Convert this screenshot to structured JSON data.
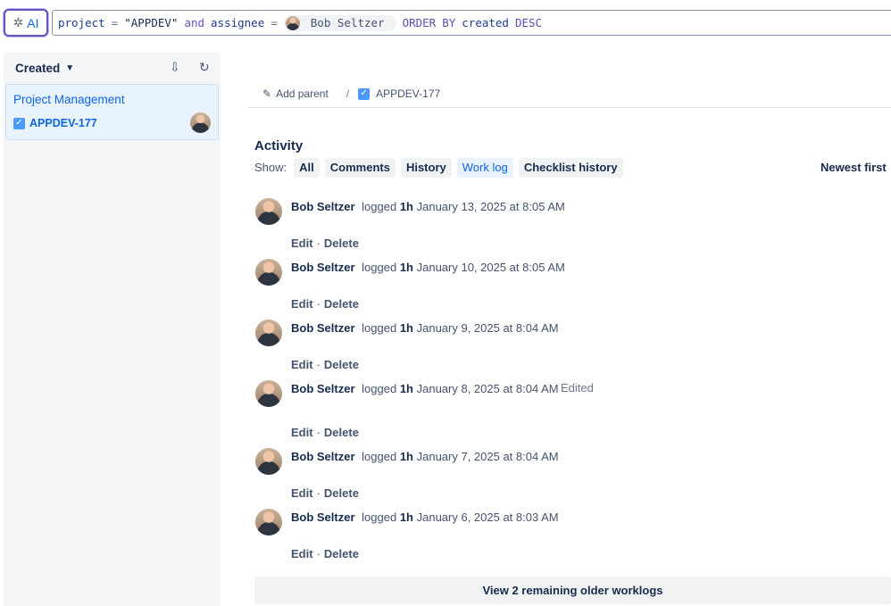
{
  "search": {
    "ai_label": "AI",
    "tokens": [
      "project",
      "=",
      "\"APPDEV\"",
      "and",
      "assignee",
      "="
    ],
    "user_chip": "Bob Seltzer",
    "order_tokens": [
      "ORDER",
      "BY",
      "created",
      "DESC"
    ]
  },
  "sidebar": {
    "sort_label": "Created",
    "card": {
      "project": "Project Management",
      "key": "APPDEV-177"
    }
  },
  "breadcrumb": {
    "add_parent": "Add parent",
    "separator": "/",
    "issue_key": "APPDEV-177"
  },
  "activity": {
    "title": "Activity",
    "show_label": "Show:",
    "filters": [
      "All",
      "Comments",
      "History",
      "Work log",
      "Checklist history"
    ],
    "active_filter": "Work log",
    "sort_label": "Newest first",
    "logged_word": "logged",
    "edit_label": "Edit",
    "delete_label": "Delete",
    "entries": [
      {
        "author": "Bob Seltzer",
        "hours": "1h",
        "date": "January 13, 2025 at 8:05 AM",
        "edited": ""
      },
      {
        "author": "Bob Seltzer",
        "hours": "1h",
        "date": "January 10, 2025 at 8:05 AM",
        "edited": ""
      },
      {
        "author": "Bob Seltzer",
        "hours": "1h",
        "date": "January 9, 2025 at 8:04 AM",
        "edited": ""
      },
      {
        "author": "Bob Seltzer",
        "hours": "1h",
        "date": "January 8, 2025 at 8:04 AM",
        "edited": "Edited"
      },
      {
        "author": "Bob Seltzer",
        "hours": "1h",
        "date": "January 7, 2025 at 8:04 AM",
        "edited": ""
      },
      {
        "author": "Bob Seltzer",
        "hours": "1h",
        "date": "January 6, 2025 at 8:03 AM",
        "edited": ""
      }
    ],
    "view_more": "View 2 remaining older worklogs"
  },
  "colors": {
    "accent": "#0c66e4",
    "ai_border": "#6554c0",
    "sidebar_bg": "#f4f5f7",
    "card_bg": "#e9f2ff"
  }
}
